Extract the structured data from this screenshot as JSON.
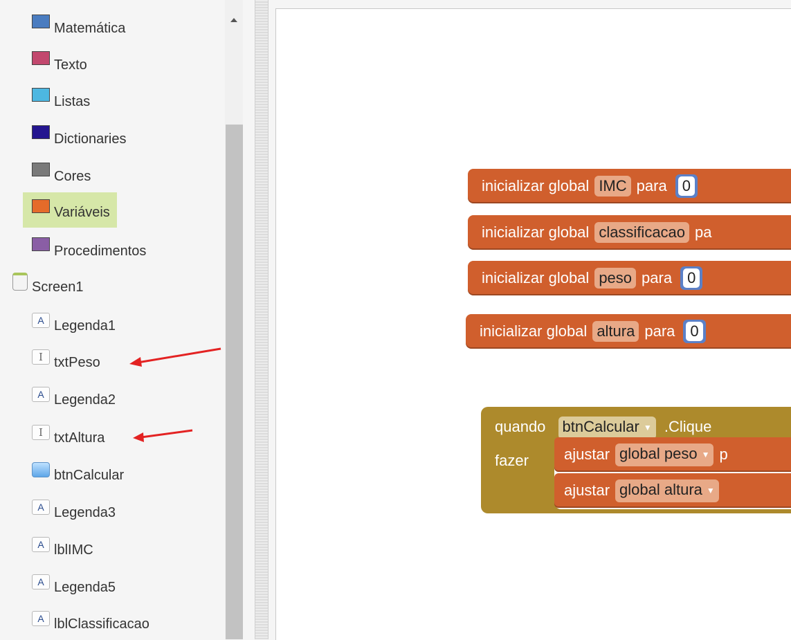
{
  "sidebar": {
    "categories": [
      {
        "label": "Matemática",
        "color": "#4a7cc0"
      },
      {
        "label": "Texto",
        "color": "#c2486e"
      },
      {
        "label": "Listas",
        "color": "#4db7e1"
      },
      {
        "label": "Dictionaries",
        "color": "#24158f"
      },
      {
        "label": "Cores",
        "color": "#7a7a7a"
      },
      {
        "label": "Variáveis",
        "color": "#e56b2a"
      },
      {
        "label": "Procedimentos",
        "color": "#8a5ea5"
      }
    ],
    "screen": "Screen1",
    "components": [
      {
        "label": "Legenda1",
        "icon": "label-icon",
        "glyph": "A"
      },
      {
        "label": "txtPeso",
        "icon": "textbox-icon",
        "glyph": "I"
      },
      {
        "label": "Legenda2",
        "icon": "label-icon",
        "glyph": "A"
      },
      {
        "label": "txtAltura",
        "icon": "textbox-icon",
        "glyph": "I"
      },
      {
        "label": "btnCalcular",
        "icon": "button-icon",
        "glyph": ""
      },
      {
        "label": "Legenda3",
        "icon": "label-icon",
        "glyph": "A"
      },
      {
        "label": "lblIMC",
        "icon": "label-icon",
        "glyph": "A"
      },
      {
        "label": "Legenda5",
        "icon": "label-icon",
        "glyph": "A"
      },
      {
        "label": "lblClassificacao",
        "icon": "label-icon",
        "glyph": "A"
      }
    ]
  },
  "workspace": {
    "globals": [
      {
        "prefix": "inicializar global",
        "name": "IMC",
        "suffix": "para",
        "value": "0"
      },
      {
        "prefix": "inicializar global",
        "name": "classificacao",
        "suffix": "pa",
        "value": ""
      },
      {
        "prefix": "inicializar global",
        "name": "peso",
        "suffix": "para",
        "value": "0"
      },
      {
        "prefix": "inicializar global",
        "name": "altura",
        "suffix": "para",
        "value": "0"
      }
    ],
    "event": {
      "when": "quando",
      "component": "btnCalcular",
      "event_name": ".Clique",
      "do": "fazer",
      "statements": [
        {
          "verb": "ajustar",
          "target": "global peso",
          "tail": "p"
        },
        {
          "verb": "ajustar",
          "target": "global altura",
          "tail": ""
        }
      ]
    }
  }
}
